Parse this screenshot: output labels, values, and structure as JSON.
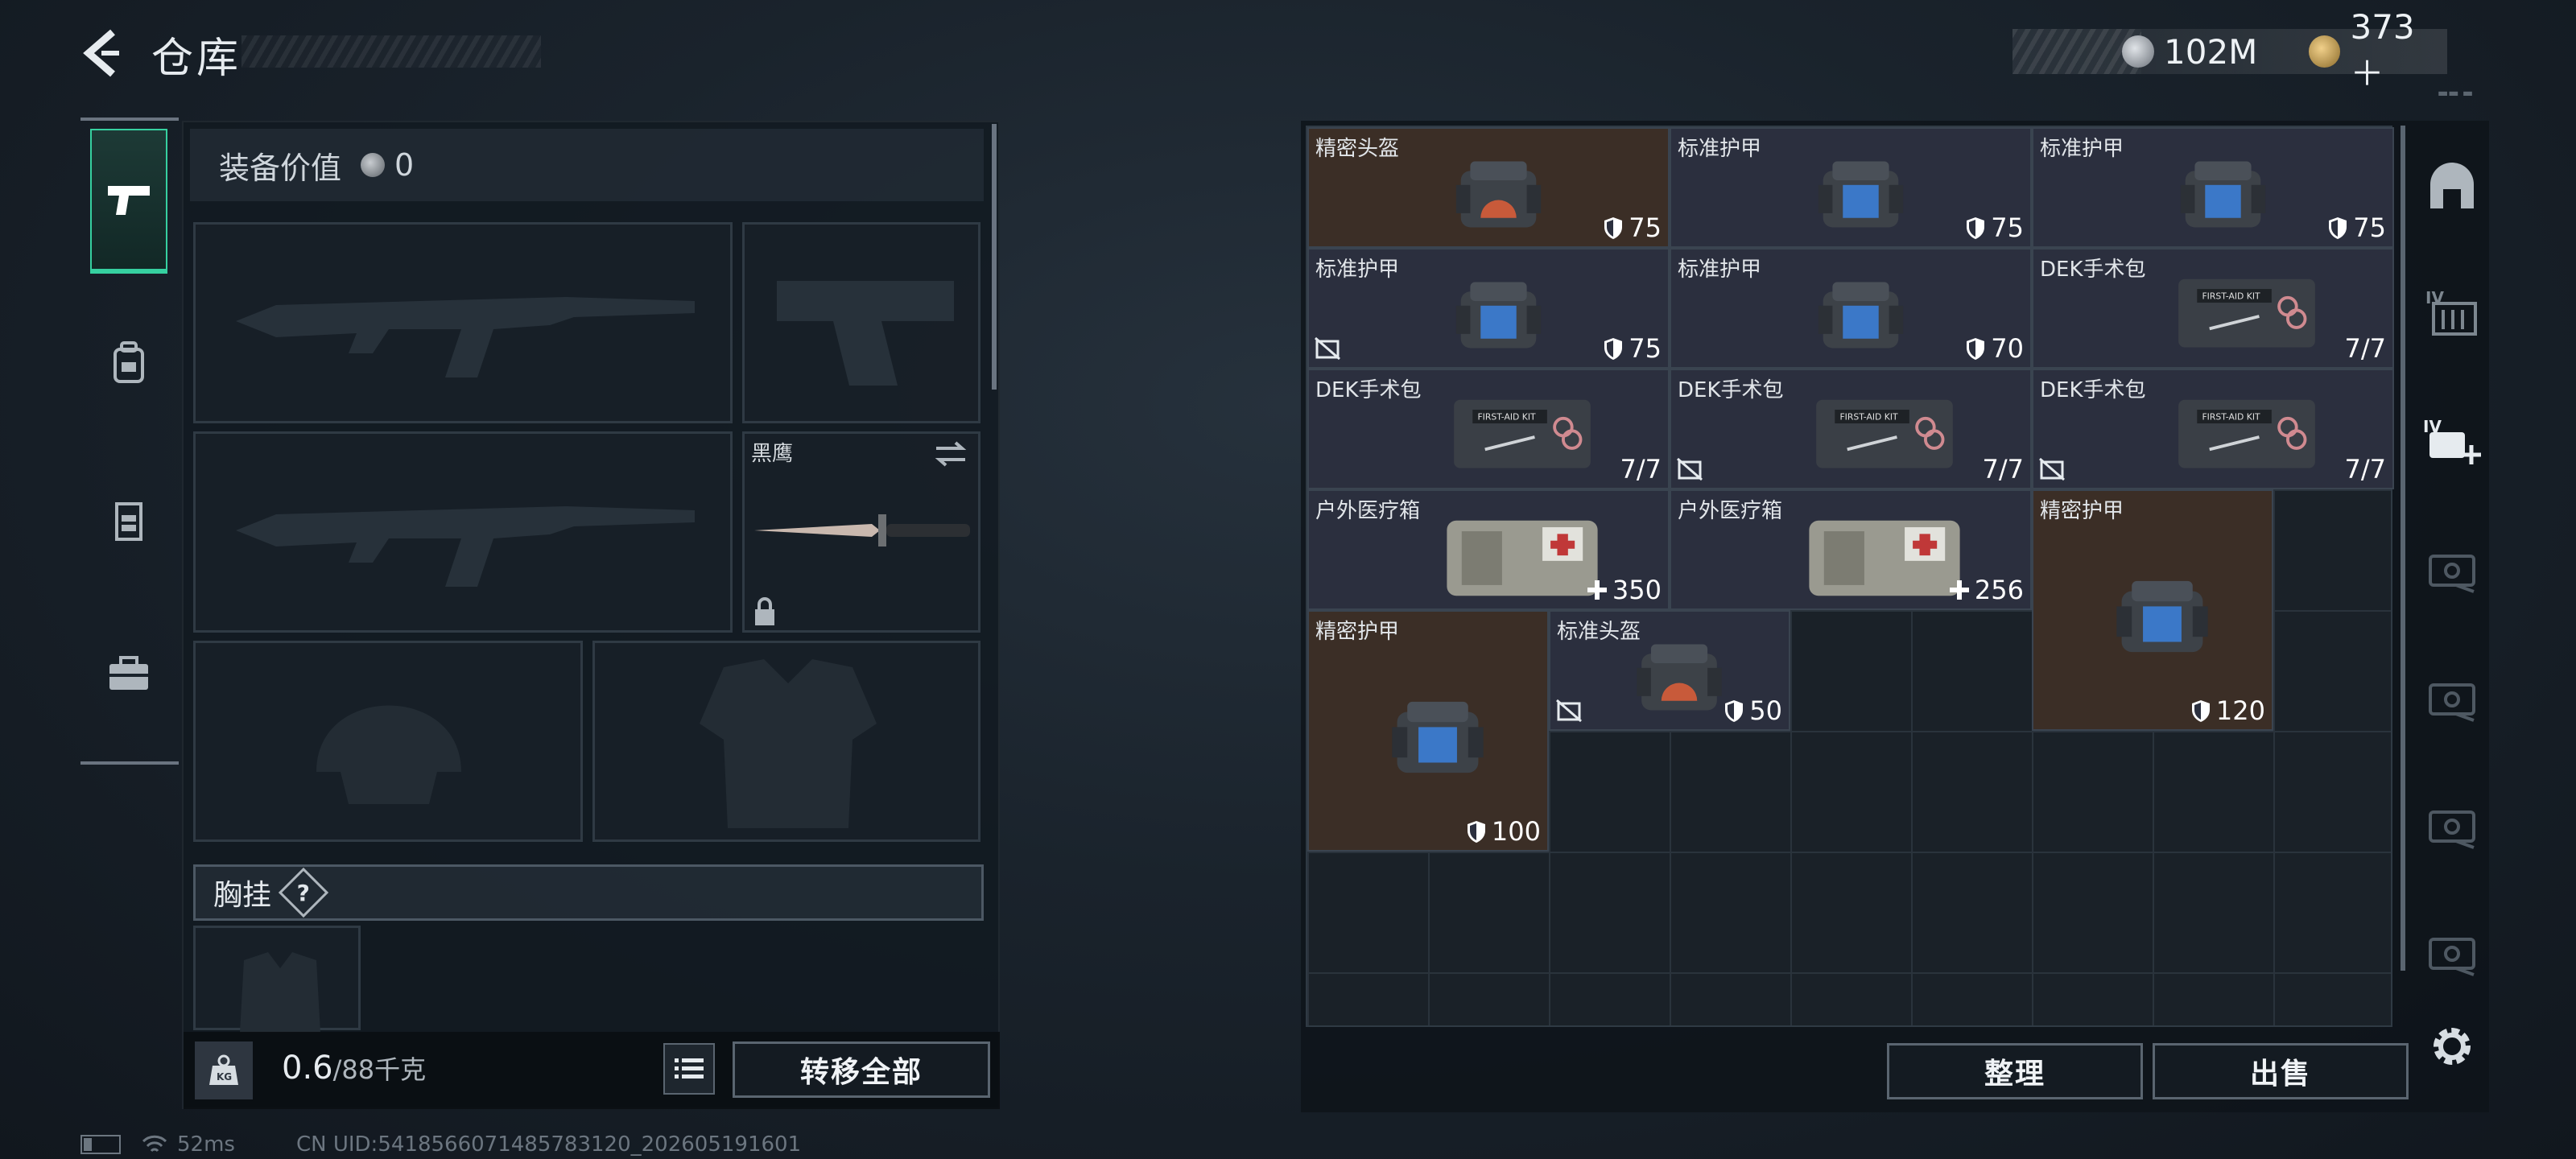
{
  "header": {
    "title": "仓库"
  },
  "currency": {
    "silver": "102M",
    "gold": "373＋"
  },
  "left_tabs": [
    "pistol-icon",
    "backpack-icon",
    "vest-icon",
    "briefcase-icon"
  ],
  "equipment": {
    "value_label": "装备价值",
    "value": "0",
    "knife_name": "黑鹰",
    "chest_rig_label": "胸挂",
    "chest_rig_help": "?",
    "weight_current": "0.6",
    "weight_max": "/88千克",
    "transfer_all": "转移全部"
  },
  "items": [
    {
      "name": "精密头盔",
      "value": "75",
      "icon": "shield",
      "bg": "brown",
      "art": "helmet"
    },
    {
      "name": "标准护甲",
      "value": "75",
      "icon": "shield",
      "bg": "gray",
      "art": "armor"
    },
    {
      "name": "标准护甲",
      "value": "75",
      "icon": "shield",
      "bg": "gray",
      "art": "armor"
    },
    {
      "name": "标准护甲",
      "value": "75",
      "icon": "shield",
      "bg": "gray",
      "art": "armor",
      "no_repair": true
    },
    {
      "name": "标准护甲",
      "value": "70",
      "icon": "shield",
      "bg": "gray",
      "art": "armor"
    },
    {
      "name": "DEK手术包",
      "value": "7/7",
      "icon": "none",
      "bg": "gray",
      "art": "kit"
    },
    {
      "name": "DEK手术包",
      "value": "7/7",
      "icon": "none",
      "bg": "gray",
      "art": "kit"
    },
    {
      "name": "DEK手术包",
      "value": "7/7",
      "icon": "none",
      "bg": "gray",
      "art": "kit",
      "no_repair": true
    },
    {
      "name": "DEK手术包",
      "value": "7/7",
      "icon": "none",
      "bg": "gray",
      "art": "kit",
      "no_repair": true
    },
    {
      "name": "户外医疗箱",
      "value": "350",
      "icon": "plus",
      "bg": "gray",
      "art": "medbox"
    },
    {
      "name": "户外医疗箱",
      "value": "256",
      "icon": "plus",
      "bg": "gray",
      "art": "medbox"
    },
    {
      "name": "精密护甲",
      "value": "120",
      "icon": "shield",
      "bg": "brown",
      "art": "armor"
    },
    {
      "name": "精密护甲",
      "value": "100",
      "icon": "shield",
      "bg": "brown",
      "art": "armor"
    },
    {
      "name": "标准头盔",
      "value": "50",
      "icon": "shield",
      "bg": "gray",
      "art": "helmet",
      "no_repair": true
    }
  ],
  "buttons": {
    "sort": "整理",
    "sell": "出售"
  },
  "right_tabs": [
    "safe-icon",
    "case-iv-icon",
    "case-iv-add-icon",
    "case-locked-icon",
    "case-locked-icon",
    "case-locked-icon",
    "case-locked-icon"
  ],
  "status": {
    "ping": "52ms",
    "uid": "CN UID:5418566071485783120_202605191601"
  },
  "colors": {
    "accent": "#36d0a0",
    "brown_rarity": "#3b2e26",
    "gray_rarity": "#2b2f3e"
  }
}
